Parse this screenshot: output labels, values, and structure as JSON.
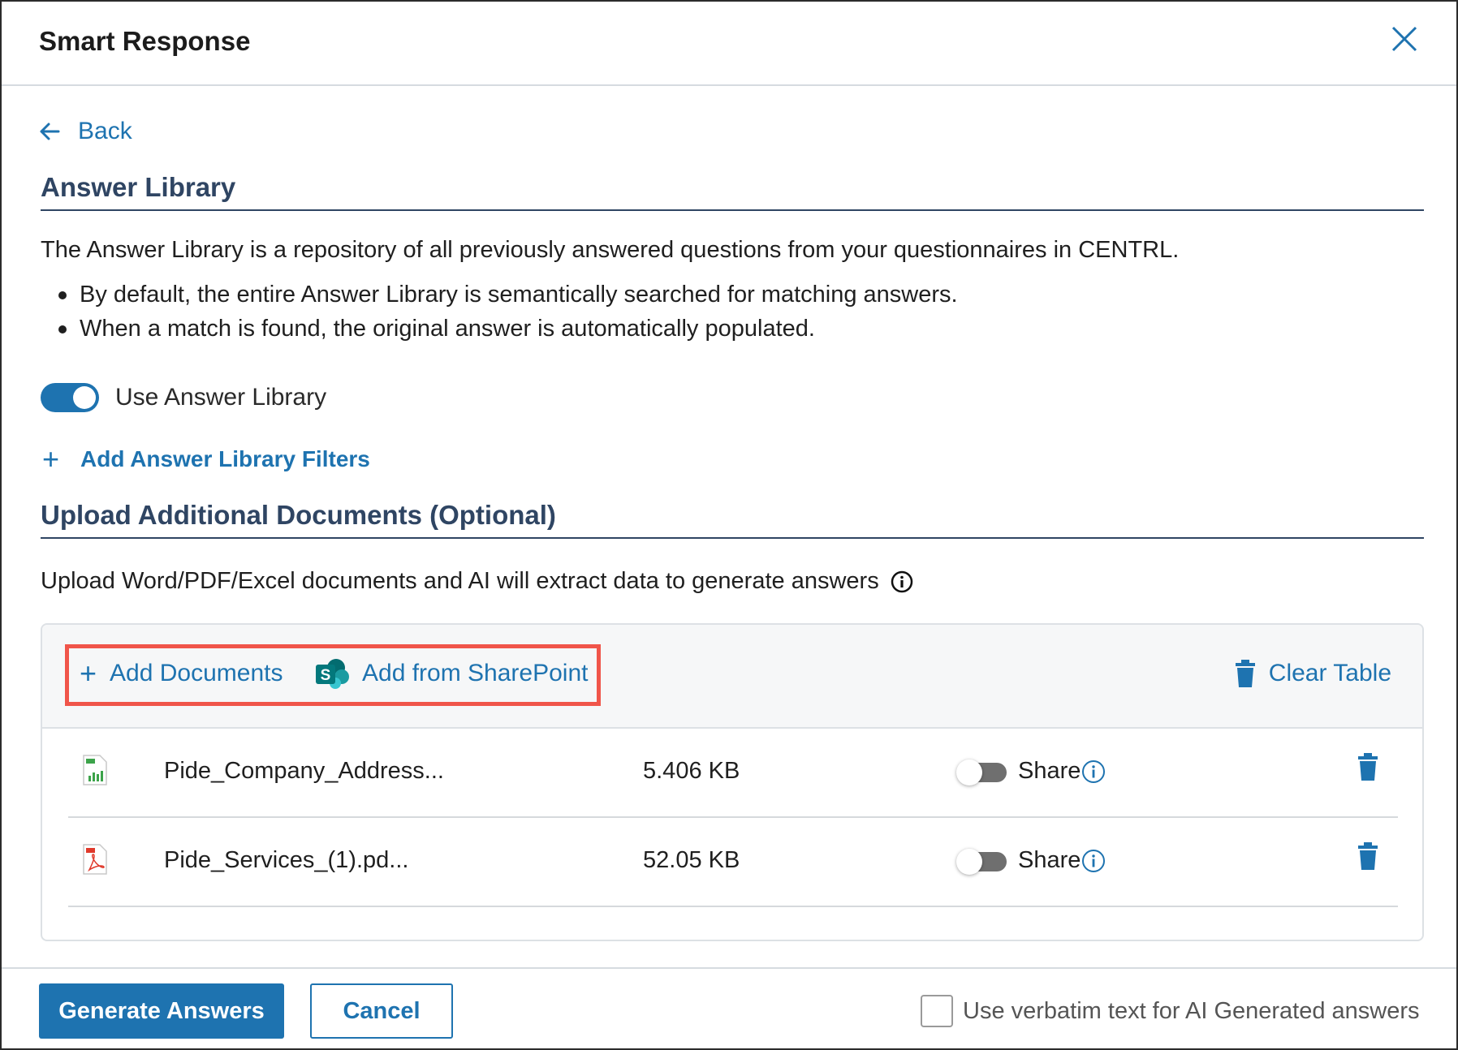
{
  "header": {
    "title": "Smart Response",
    "close_icon": "close-icon"
  },
  "back": {
    "label": "Back",
    "icon": "arrow-left-icon"
  },
  "answer_library": {
    "title": "Answer Library",
    "description": "The Answer Library is a repository of all previously answered questions from your questionnaires in CENTRL.",
    "bullets": [
      "By default, the entire Answer Library is semantically searched for matching answers.",
      "When a match is found, the original answer is automatically populated."
    ],
    "toggle_label": "Use Answer Library",
    "toggle_on": true,
    "add_filters_label": "Add Answer Library Filters"
  },
  "upload": {
    "title": "Upload Additional Documents (Optional)",
    "description": "Upload Word/PDF/Excel documents and AI will extract data to generate answers",
    "add_documents_label": "Add Documents",
    "add_sharepoint_label": "Add from SharePoint",
    "clear_table_label": "Clear Table",
    "files": [
      {
        "name": "Pide_Company_Address...",
        "size": "5.406 KB",
        "type": "excel",
        "share_label": "Share",
        "shared": false
      },
      {
        "name": "Pide_Services_(1).pd...",
        "size": "52.05 KB",
        "type": "pdf",
        "share_label": "Share",
        "shared": false
      }
    ]
  },
  "footer": {
    "generate_label": "Generate Answers",
    "cancel_label": "Cancel",
    "verbatim_label": "Use verbatim text for AI Generated answers",
    "verbatim_checked": false
  },
  "colors": {
    "accent": "#1e73b0",
    "heading": "#2f4563",
    "highlight": "#f0554a"
  }
}
